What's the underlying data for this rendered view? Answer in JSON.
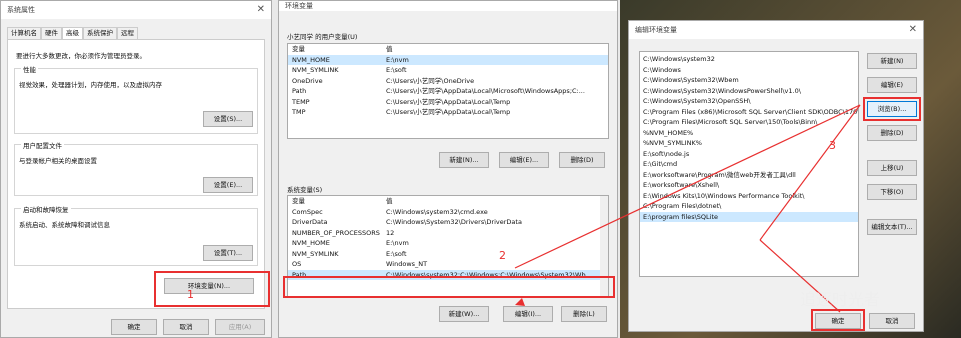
{
  "left": {
    "title": "系统属性",
    "tabs": [
      "计算机名",
      "硬件",
      "高级",
      "系统保护",
      "远程"
    ],
    "admin_note": "要进行大多数更改，你必须作为管理员登录。",
    "perf": {
      "title": "性能",
      "desc": "视觉效果，处理器计划，内存使用，以及虚拟内存",
      "btn": "设置(S)..."
    },
    "profile": {
      "title": "用户配置文件",
      "desc": "与登录帐户相关的桌面设置",
      "btn": "设置(E)..."
    },
    "startup": {
      "title": "启动和故障恢复",
      "desc": "系统启动、系统故障和调试信息",
      "btn": "设置(T)..."
    },
    "env_btn": "环境变量(N)...",
    "ok": "确定",
    "cancel": "取消",
    "apply": "应用(A)"
  },
  "mid": {
    "title": "环境变量",
    "user_group": "小艺同学 的用户变量(U)",
    "col_var": "变量",
    "col_val": "值",
    "user_vars": [
      [
        "NVM_HOME",
        "E:\\nvm"
      ],
      [
        "NVM_SYMLINK",
        "E:\\soft"
      ],
      [
        "OneDrive",
        "C:\\Users\\小艺同学\\OneDrive"
      ],
      [
        "Path",
        "C:\\Users\\小艺同学\\AppData\\Local\\Microsoft\\WindowsApps;C:..."
      ],
      [
        "TEMP",
        "C:\\Users\\小艺同学\\AppData\\Local\\Temp"
      ],
      [
        "TMP",
        "C:\\Users\\小艺同学\\AppData\\Local\\Temp"
      ]
    ],
    "user_new": "新建(N)...",
    "user_edit": "编辑(E)...",
    "user_del": "删除(D)",
    "sys_group": "系统变量(S)",
    "sys_vars": [
      [
        "ComSpec",
        "C:\\Windows\\system32\\cmd.exe"
      ],
      [
        "DriverData",
        "C:\\Windows\\System32\\Drivers\\DriverData"
      ],
      [
        "NUMBER_OF_PROCESSORS",
        "12"
      ],
      [
        "NVM_HOME",
        "E:\\nvm"
      ],
      [
        "NVM_SYMLINK",
        "E:\\soft"
      ],
      [
        "OS",
        "Windows_NT"
      ],
      [
        "Path",
        "C:\\Windows\\system32;C:\\Windows;C:\\Windows\\System32\\Wb..."
      ]
    ],
    "sys_new": "新建(W)...",
    "sys_edit": "编辑(I)...",
    "sys_del": "删除(L)"
  },
  "right": {
    "title": "编辑环境变量",
    "paths": [
      "C:\\Windows\\system32",
      "C:\\Windows",
      "C:\\Windows\\System32\\Wbem",
      "C:\\Windows\\System32\\WindowsPowerShell\\v1.0\\",
      "C:\\Windows\\System32\\OpenSSH\\",
      "C:\\Program Files (x86)\\Microsoft SQL Server\\Client SDK\\ODBC\\170\\T...",
      "C:\\Program Files\\Microsoft SQL Server\\150\\Tools\\Binn\\",
      "%NVM_HOME%",
      "%NVM_SYMLINK%",
      "E:\\soft\\node.js",
      "E:\\Git\\cmd",
      "E:\\worksoftware\\Program\\微信web开发者工具\\dll",
      "E:\\worksoftware\\Xshell\\",
      "E:\\Windows Kits\\10\\Windows Performance Toolkit\\",
      "C:\\Program Files\\dotnet\\",
      "E:\\program files\\SQLite"
    ],
    "btn_new": "新建(N)",
    "btn_edit": "编辑(E)",
    "btn_browse": "浏览(B)...",
    "btn_del": "删除(D)",
    "btn_up": "上移(U)",
    "btn_down": "下移(O)",
    "btn_edittext": "编辑文本(T)...",
    "ok": "确定",
    "cancel": "取消"
  },
  "annotations": {
    "n1": "1",
    "n2": "2",
    "n3": "3",
    "watermark": "追逐时光者"
  }
}
